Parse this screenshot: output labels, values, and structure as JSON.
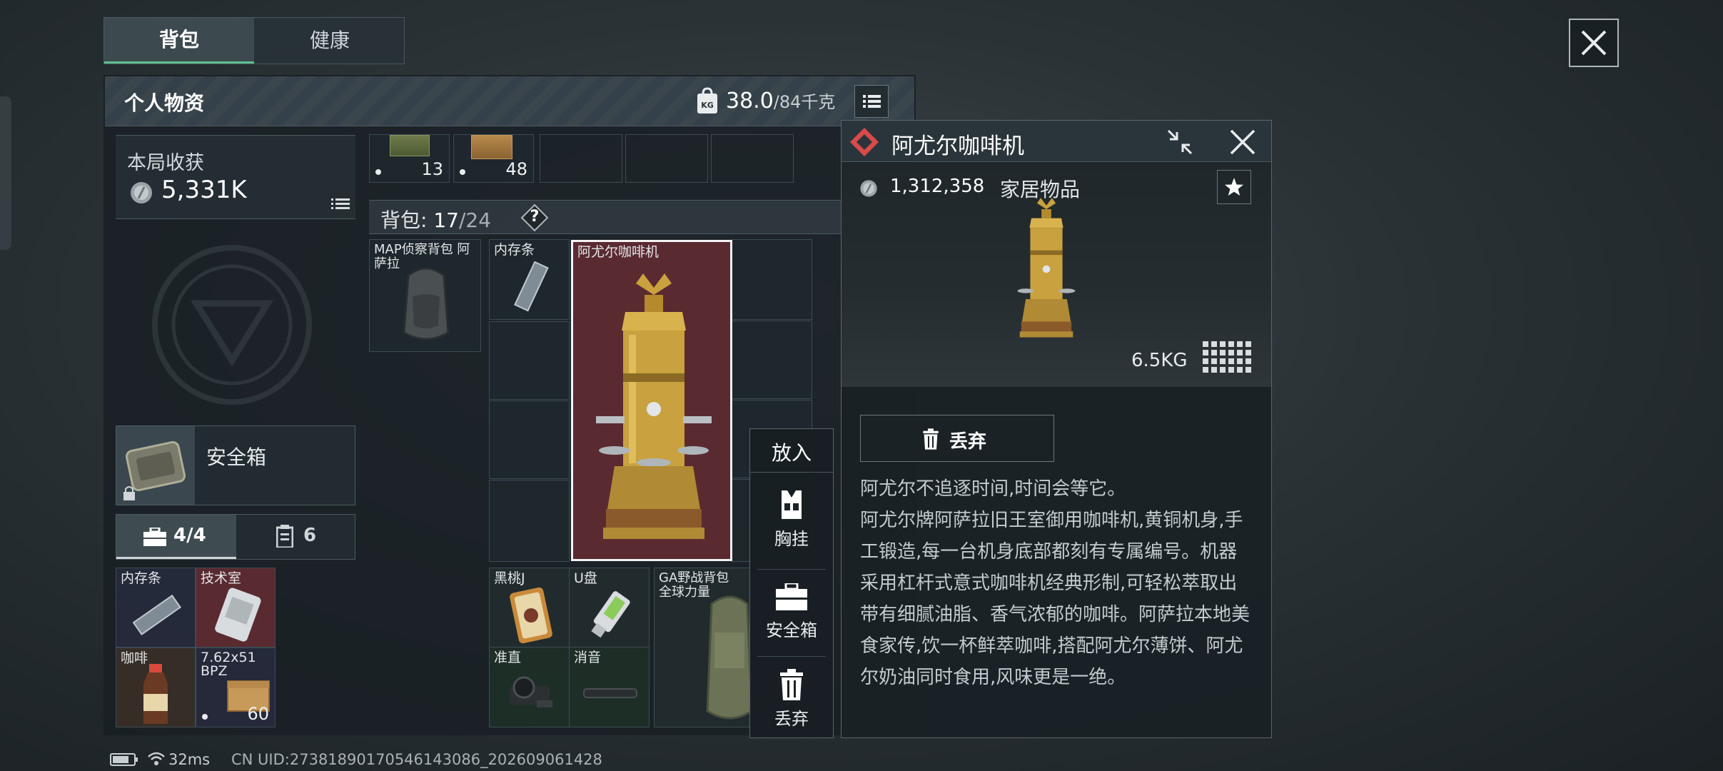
{
  "tabs": [
    {
      "label": "背包",
      "active": true
    },
    {
      "label": "健康",
      "active": false
    }
  ],
  "personal": {
    "title": "个人物资",
    "weight_current": "38.0",
    "weight_max": "/84千克"
  },
  "earnings": {
    "label": "本局收获",
    "value": "5,331K"
  },
  "top_row": [
    {
      "count": "13"
    },
    {
      "count": "48"
    }
  ],
  "backpack_bar": {
    "label": "背包:",
    "used": "17",
    "capacity": "/24",
    "help": "?"
  },
  "backpack_items": {
    "map_pack": "MAP侦察背包 阿萨拉",
    "memory1": "内存条",
    "coffee_machine": "阿尤尔咖啡机",
    "black_peach": "黑桃J",
    "usb": "U盘",
    "ga_pack": "GA野战背包 全球力量",
    "scope": "准直",
    "silencer": "消音"
  },
  "safebox": {
    "label": "安全箱",
    "tab1_count": "4/4",
    "tab2_count": "6"
  },
  "safebox_items": [
    {
      "label": "内存条"
    },
    {
      "label": "技术室"
    },
    {
      "label": "咖啡"
    },
    {
      "label": "7.62x51 BPZ",
      "count": "60"
    }
  ],
  "action_menu": {
    "title": "放入",
    "items": [
      {
        "label": "胸挂",
        "icon": "vest-icon"
      },
      {
        "label": "安全箱",
        "icon": "briefcase-icon"
      },
      {
        "label": "丢弃",
        "icon": "trash-icon"
      }
    ]
  },
  "detail": {
    "title": "阿尤尔咖啡机",
    "price": "1,312,358",
    "category": "家居物品",
    "weight": "6.5KG",
    "discard_label": "丢弃",
    "description": "阿尤尔不追逐时间,时间会等它。\n阿尤尔牌阿萨拉旧王室御用咖啡机,黄铜机身,手工锻造,每一台机身底部都刻有专属编号。机器采用杠杆式意式咖啡机经典形制,可轻松萃取出带有细腻油脂、香气浓郁的咖啡。阿萨拉本地美食家传,饮一杯鲜萃咖啡,搭配阿尤尔薄饼、阿尤尔奶油同时食用,风味更是一绝。",
    "rarity_color": "#d94a4a"
  },
  "status_bar": {
    "ping": "32ms",
    "uid": "CN UID:27381890170546143086_202609061428"
  },
  "colors": {
    "accent_green": "#5fbf8f",
    "brass": "#c9a13e",
    "highlight_red_bg": "#5a2a31"
  }
}
